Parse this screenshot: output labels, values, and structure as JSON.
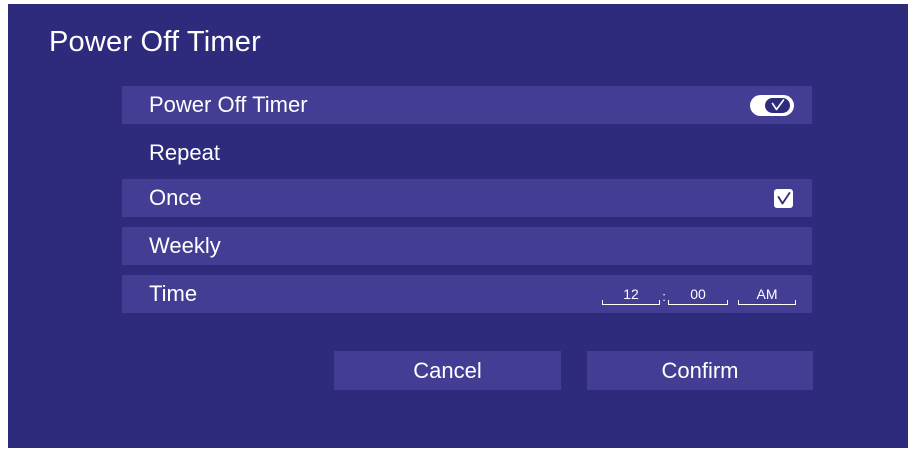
{
  "dialog": {
    "title": "Power Off Timer"
  },
  "rows": {
    "power_off_timer": {
      "label": "Power Off Timer",
      "toggle_on": true
    },
    "repeat": {
      "label": "Repeat"
    },
    "once": {
      "label": "Once",
      "checked": true
    },
    "weekly": {
      "label": "Weekly"
    },
    "time": {
      "label": "Time",
      "hour": "12",
      "separator": ":",
      "minute": "00",
      "period": "AM"
    }
  },
  "buttons": {
    "cancel": "Cancel",
    "confirm": "Confirm"
  },
  "colors": {
    "dialog_background": "#2e2a7c",
    "row_highlight": "#443d94",
    "text": "#ffffff"
  }
}
